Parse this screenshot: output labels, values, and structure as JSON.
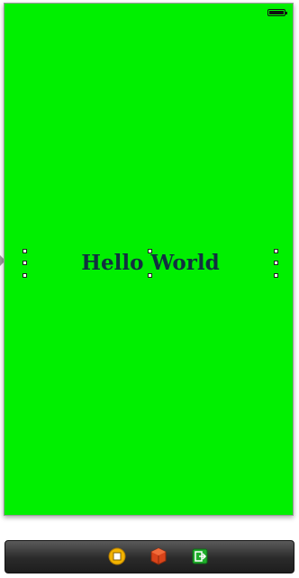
{
  "scene": {
    "background_color": "#00f000",
    "label_text": "Hello World"
  },
  "dock": {
    "icons": [
      "view-controller-icon",
      "first-responder-icon",
      "exit-icon"
    ]
  }
}
